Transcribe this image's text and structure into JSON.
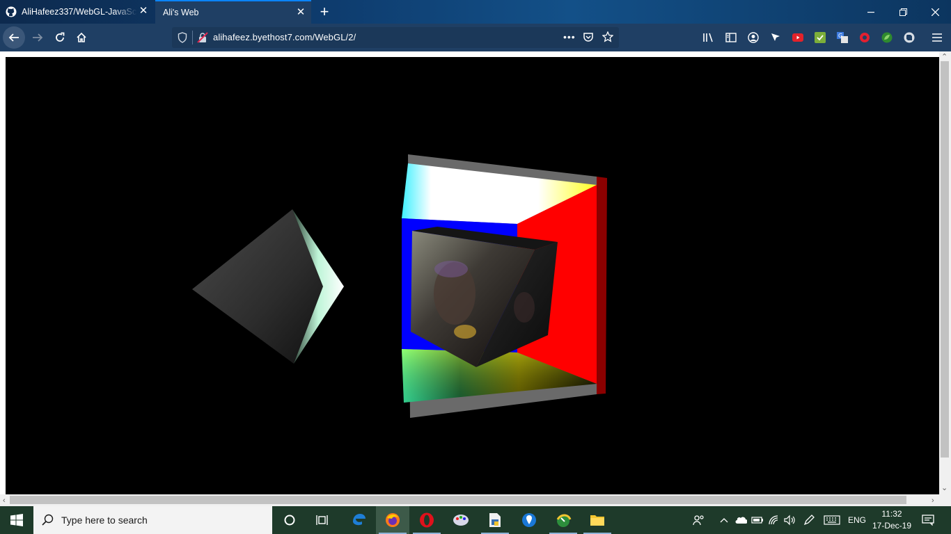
{
  "browser": {
    "tabs": [
      {
        "title": "AliHafeez337/WebGL-JavaScrip",
        "icon": "github-icon",
        "active": false
      },
      {
        "title": "Ali's Web",
        "icon": "none",
        "active": true
      }
    ],
    "url": "alihafeez.byethost7.com/WebGL/2/",
    "accent": "#0a84ff"
  },
  "scene": {
    "background": "#000000",
    "objects": [
      "gradient-pyramid",
      "color-box-room",
      "textured-cube"
    ]
  },
  "taskbar": {
    "search_placeholder": "Type here to search",
    "language": "ENG",
    "time": "11:32",
    "date": "17-Dec-19"
  }
}
